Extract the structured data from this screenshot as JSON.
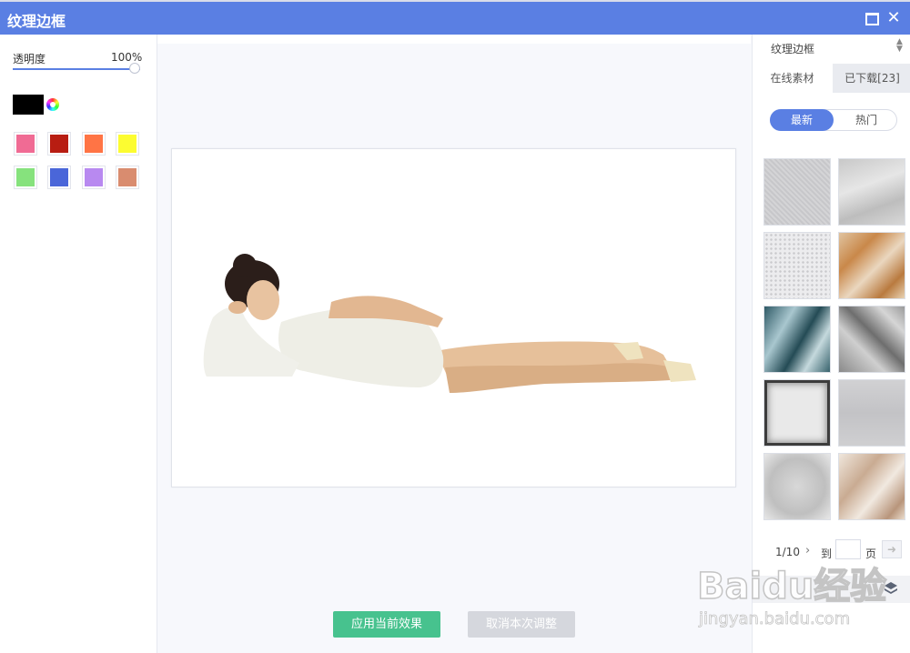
{
  "window": {
    "title": "纹理边框",
    "maximize_icon": "maximize-icon",
    "close_icon": "close-icon"
  },
  "left_panel": {
    "opacity_label": "透明度",
    "opacity_value": "100%",
    "opacity_level": 1.0,
    "current_color": "#000000",
    "swatches": [
      "#f06b94",
      "#b81d12",
      "#ff7445",
      "#fcfc31",
      "#86e27d",
      "#4a66d9",
      "#b889f0",
      "#d98c6f"
    ]
  },
  "canvas": {
    "apply_label": "应用当前效果",
    "cancel_label": "取消本次调整"
  },
  "right_panel": {
    "category": "纹理边框",
    "tabs": [
      "在线素材",
      "已下载[23]"
    ],
    "filters": [
      "最新",
      "热门"
    ],
    "pagination": {
      "page": "1/10",
      "goto_label": "到",
      "page_label": "页",
      "page_input": ""
    }
  },
  "watermark": {
    "logo": "Baidu经验",
    "url": "jingyan.baidu.com"
  }
}
